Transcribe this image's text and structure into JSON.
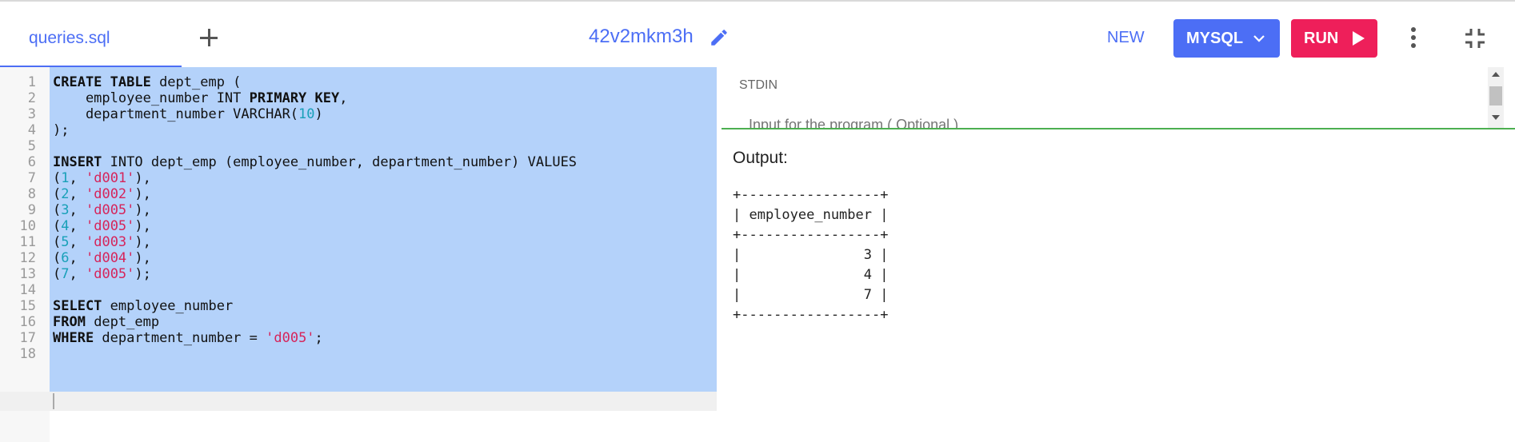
{
  "tab": {
    "label": "queries.sql"
  },
  "title": "42v2mkm3h",
  "toolbar": {
    "new_label": "NEW",
    "language_label": "MYSQL",
    "run_label": "RUN"
  },
  "colors": {
    "accent": "#4c6ef5",
    "run": "#ee1f5a",
    "selection": "#b4d2fa",
    "stdin_border": "#4caf50"
  },
  "editor": {
    "line_numbers": [
      "1",
      "2",
      "3",
      "4",
      "5",
      "6",
      "7",
      "8",
      "9",
      "10",
      "11",
      "12",
      "13",
      "14",
      "15",
      "16",
      "17",
      "18"
    ],
    "lines": [
      [
        {
          "t": "CREATE TABLE",
          "c": "kw"
        },
        {
          "t": " dept_emp (",
          "c": ""
        }
      ],
      [
        {
          "t": "    employee_number INT ",
          "c": ""
        },
        {
          "t": "PRIMARY KEY",
          "c": "kw"
        },
        {
          "t": ",",
          "c": ""
        }
      ],
      [
        {
          "t": "    department_number VARCHAR(",
          "c": ""
        },
        {
          "t": "10",
          "c": "num"
        },
        {
          "t": ")",
          "c": ""
        }
      ],
      [
        {
          "t": ");",
          "c": ""
        }
      ],
      [],
      [
        {
          "t": "INSERT",
          "c": "kw"
        },
        {
          "t": " INTO dept_emp (employee_number, department_number) VALUES",
          "c": ""
        }
      ],
      [
        {
          "t": "(",
          "c": ""
        },
        {
          "t": "1",
          "c": "num"
        },
        {
          "t": ", ",
          "c": ""
        },
        {
          "t": "'d001'",
          "c": "str"
        },
        {
          "t": "),",
          "c": ""
        }
      ],
      [
        {
          "t": "(",
          "c": ""
        },
        {
          "t": "2",
          "c": "num"
        },
        {
          "t": ", ",
          "c": ""
        },
        {
          "t": "'d002'",
          "c": "str"
        },
        {
          "t": "),",
          "c": ""
        }
      ],
      [
        {
          "t": "(",
          "c": ""
        },
        {
          "t": "3",
          "c": "num"
        },
        {
          "t": ", ",
          "c": ""
        },
        {
          "t": "'d005'",
          "c": "str"
        },
        {
          "t": "),",
          "c": ""
        }
      ],
      [
        {
          "t": "(",
          "c": ""
        },
        {
          "t": "4",
          "c": "num"
        },
        {
          "t": ", ",
          "c": ""
        },
        {
          "t": "'d005'",
          "c": "str"
        },
        {
          "t": "),",
          "c": ""
        }
      ],
      [
        {
          "t": "(",
          "c": ""
        },
        {
          "t": "5",
          "c": "num"
        },
        {
          "t": ", ",
          "c": ""
        },
        {
          "t": "'d003'",
          "c": "str"
        },
        {
          "t": "),",
          "c": ""
        }
      ],
      [
        {
          "t": "(",
          "c": ""
        },
        {
          "t": "6",
          "c": "num"
        },
        {
          "t": ", ",
          "c": ""
        },
        {
          "t": "'d004'",
          "c": "str"
        },
        {
          "t": "),",
          "c": ""
        }
      ],
      [
        {
          "t": "(",
          "c": ""
        },
        {
          "t": "7",
          "c": "num"
        },
        {
          "t": ", ",
          "c": ""
        },
        {
          "t": "'d005'",
          "c": "str"
        },
        {
          "t": ");",
          "c": ""
        }
      ],
      [],
      [
        {
          "t": "SELECT",
          "c": "kw"
        },
        {
          "t": " employee_number",
          "c": ""
        }
      ],
      [
        {
          "t": "FROM",
          "c": "kw"
        },
        {
          "t": " dept_emp",
          "c": ""
        }
      ],
      [
        {
          "t": "WHERE",
          "c": "kw"
        },
        {
          "t": " department_number = ",
          "c": ""
        },
        {
          "t": "'d005'",
          "c": "str"
        },
        {
          "t": ";",
          "c": ""
        }
      ],
      []
    ]
  },
  "stdin": {
    "label": "STDIN",
    "placeholder": "Input for the program ( Optional )"
  },
  "output": {
    "label": "Output:",
    "text": "+-----------------+\n| employee_number |\n+-----------------+\n|               3 |\n|               4 |\n|               7 |\n+-----------------+"
  }
}
